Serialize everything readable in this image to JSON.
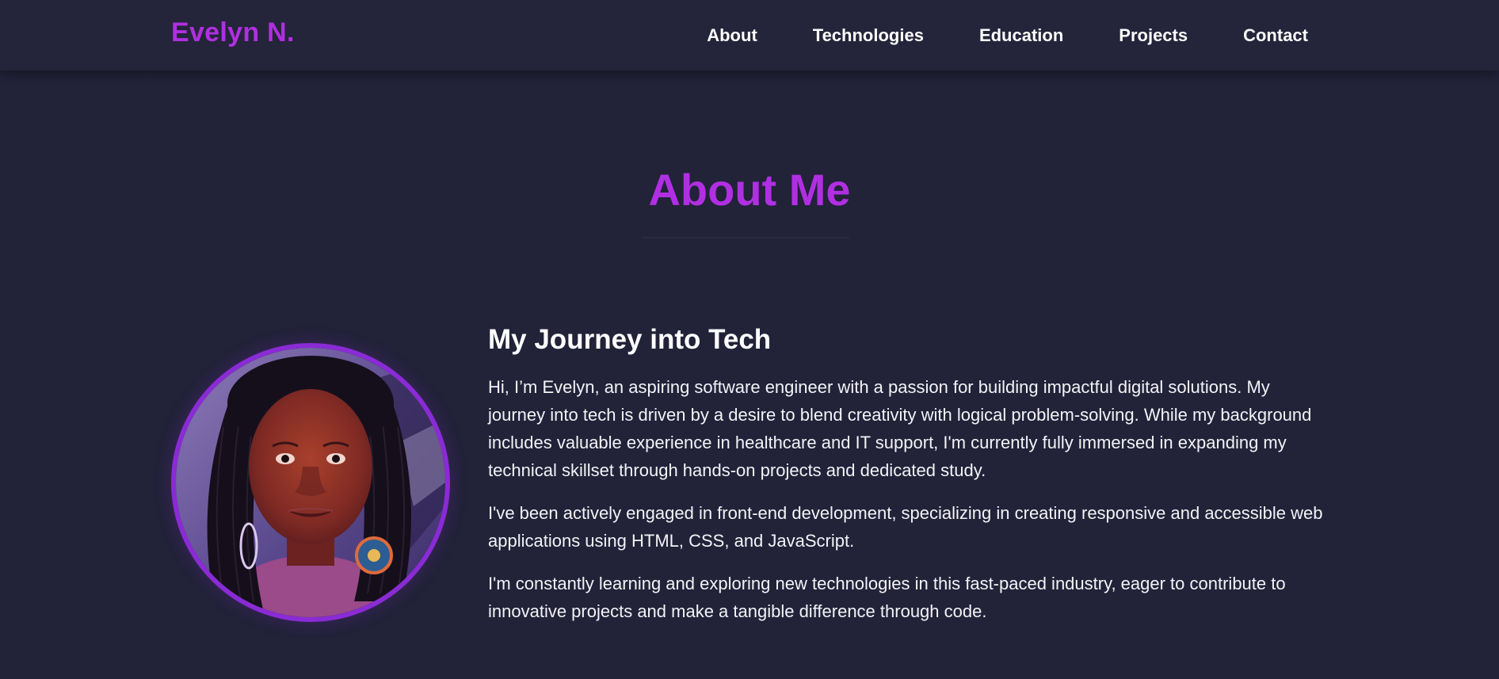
{
  "header": {
    "logo": "Evelyn N.",
    "nav": [
      {
        "label": "About"
      },
      {
        "label": "Technologies"
      },
      {
        "label": "Education"
      },
      {
        "label": "Projects"
      },
      {
        "label": "Contact"
      }
    ]
  },
  "about": {
    "title": "About Me",
    "heading": "My Journey into Tech",
    "paragraphs": [
      "Hi, I’m Evelyn, an aspiring software engineer with a passion for building impactful digital solutions. My journey into tech is driven by a desire to blend creativity with logical problem-solving. While my background includes valuable experience in healthcare and IT support, I'm currently fully immersed in expanding my technical skillset through hands-on projects and dedicated study.",
      "I've been actively engaged in front-end development, specializing in creating responsive and accessible web applications using HTML, CSS, and JavaScript.",
      "I'm constantly learning and exploring new technologies in this fast-paced industry, eager to contribute to innovative projects and make a tangible difference through code."
    ]
  },
  "colors": {
    "accent": "#b12fe2",
    "portrait_border": "#8a2bd6",
    "background": "#222239",
    "header_bg": "#24243a"
  }
}
